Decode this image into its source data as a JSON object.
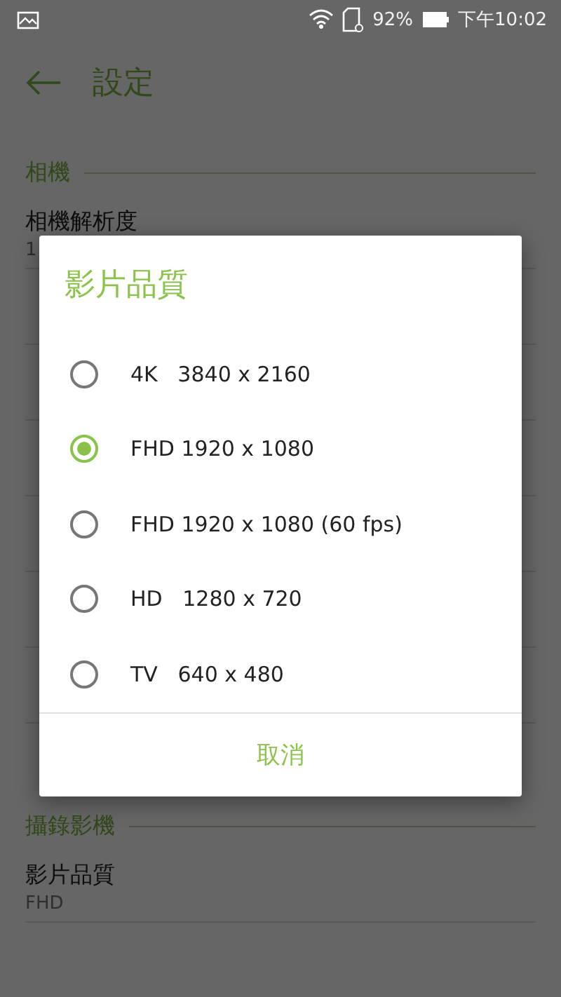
{
  "status_bar": {
    "battery": "92%",
    "time": "下午10:02"
  },
  "app_bar": {
    "title": "設定"
  },
  "sections": [
    {
      "header": "相機",
      "items": [
        {
          "title": "相機解析度",
          "subtitle": "1"
        }
      ]
    },
    {
      "header": "攝錄影機",
      "items": [
        {
          "title": "影片品質",
          "subtitle": "FHD"
        }
      ]
    }
  ],
  "dialog": {
    "title": "影片品質",
    "options": [
      {
        "label": "4K   3840 x 2160",
        "selected": false
      },
      {
        "label": "FHD 1920 x 1080",
        "selected": true
      },
      {
        "label": "FHD 1920 x 1080 (60 fps)",
        "selected": false
      },
      {
        "label": "HD   1280 x 720",
        "selected": false
      },
      {
        "label": "TV   640 x 480",
        "selected": false
      }
    ],
    "button": "取消"
  }
}
